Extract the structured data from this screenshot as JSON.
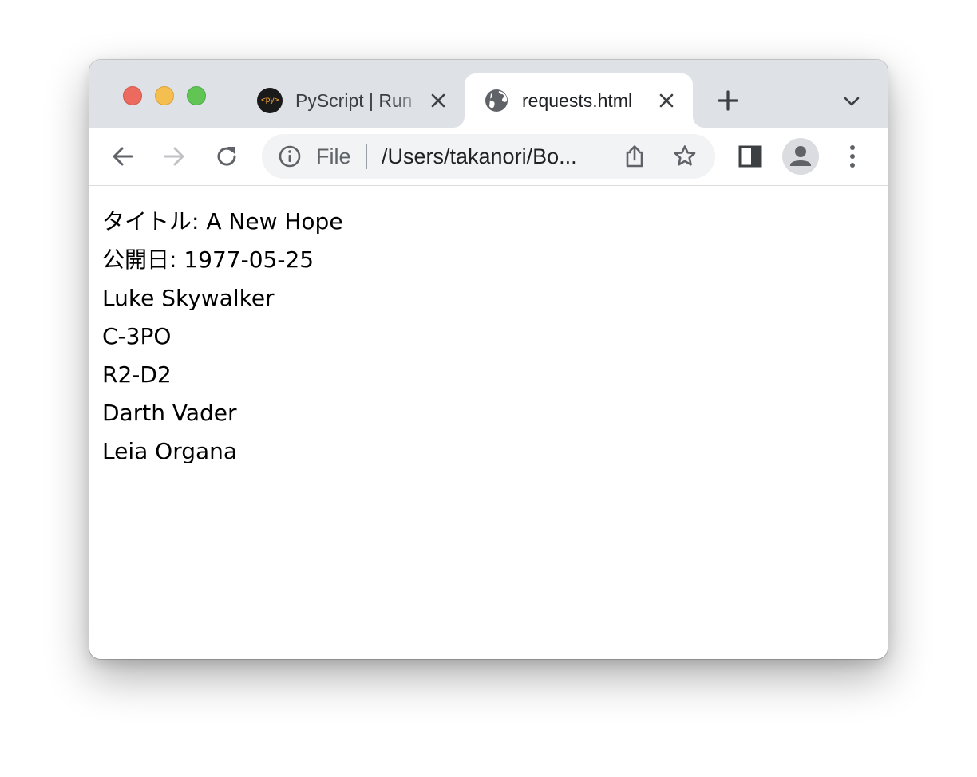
{
  "browser": {
    "tabs": [
      {
        "title": "PyScript | Run",
        "favicon_text": "<py>",
        "active": false
      },
      {
        "title": "requests.html",
        "favicon": "globe-icon",
        "active": true
      }
    ],
    "address_bar": {
      "chip": "File",
      "url": "/Users/takanori/Bo..."
    },
    "colors": {
      "tab_strip": "#dee1e6",
      "toolbar": "#ffffff",
      "omnibox": "#f1f3f4",
      "traffic_red": "#ed6a5e",
      "traffic_yellow": "#f5bf4f",
      "traffic_green": "#61c554"
    }
  },
  "page": {
    "title_label": "タイトル: ",
    "title_value": "A New Hope",
    "release_label": "公開日: ",
    "release_value": "1977-05-25",
    "characters": [
      "Luke Skywalker",
      "C-3PO",
      "R2-D2",
      "Darth Vader",
      "Leia Organa"
    ]
  }
}
